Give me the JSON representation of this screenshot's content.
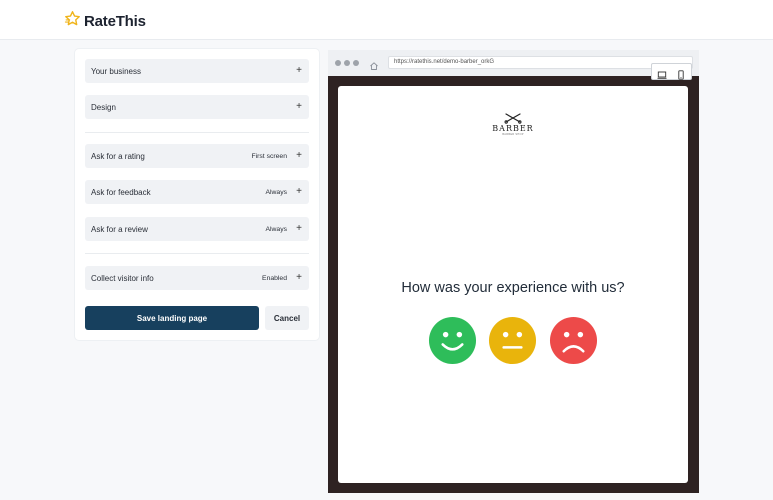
{
  "app": {
    "name": "RateThis"
  },
  "panel": {
    "sections_top": [
      {
        "label": "Your business",
        "value": ""
      },
      {
        "label": "Design",
        "value": ""
      }
    ],
    "sections_flow": [
      {
        "label": "Ask for a rating",
        "value": "First screen"
      },
      {
        "label": "Ask for feedback",
        "value": "Always"
      },
      {
        "label": "Ask for a review",
        "value": "Always"
      }
    ],
    "sections_extra": [
      {
        "label": "Collect visitor info",
        "value": "Enabled"
      }
    ],
    "expand_symbol": "+",
    "save_label": "Save landing page",
    "cancel_label": "Cancel"
  },
  "preview": {
    "url": "https://ratethis.net/demo-barber_orkG",
    "brand": {
      "name": "BARBER",
      "tagline": "BARBER SHOP"
    },
    "question": "How was your experience with us?",
    "faces": [
      {
        "name": "happy",
        "color": "#2ebd5a"
      },
      {
        "name": "neutral",
        "color": "#e9b40c"
      },
      {
        "name": "sad",
        "color": "#ed4a49"
      }
    ]
  },
  "colors": {
    "brand_star": "#f0b41a",
    "primary_button": "#17405e",
    "device_frame": "#2e2222"
  }
}
